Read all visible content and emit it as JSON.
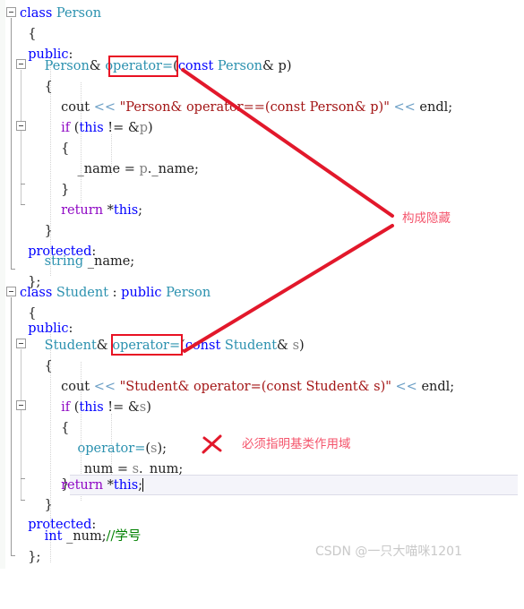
{
  "editor": {
    "language": "cpp",
    "background": "#ffffff",
    "current_line_index": 22,
    "caret_visible": true,
    "colors": {
      "keyword": "#0000ff",
      "type": "#2b91af",
      "control": "#8f08c4",
      "string": "#a31515",
      "comment": "#008000",
      "identifier": "#1f1f1f",
      "variable": "#808080",
      "stream_operator": "#6a9ec5",
      "annotation_box": "#e81123",
      "annotation_text": "#f4556c",
      "watermark": "#c9c9c9"
    },
    "lines": [
      {
        "n": 0,
        "indent": 0,
        "text": "class Person"
      },
      {
        "n": 1,
        "indent": 1,
        "text": "{"
      },
      {
        "n": 2,
        "indent": 1,
        "text": "public:"
      },
      {
        "n": 3,
        "indent": 2,
        "text": "Person& operator=(const Person& p)"
      },
      {
        "n": 4,
        "indent": 2,
        "text": "{"
      },
      {
        "n": 5,
        "indent": 3,
        "text": "cout << \"Person& operator==(const Person& p)\" << endl;"
      },
      {
        "n": 6,
        "indent": 3,
        "text": "if (this != &p)"
      },
      {
        "n": 7,
        "indent": 3,
        "text": "{"
      },
      {
        "n": 8,
        "indent": 4,
        "text": "_name = p._name;"
      },
      {
        "n": 9,
        "indent": 3,
        "text": "}"
      },
      {
        "n": 10,
        "indent": 3,
        "text": "return *this;"
      },
      {
        "n": 11,
        "indent": 2,
        "text": "}"
      },
      {
        "n": 12,
        "indent": 1,
        "text": "protected:"
      },
      {
        "n": 13,
        "indent": 2,
        "text": "string _name;"
      },
      {
        "n": 14,
        "indent": 1,
        "text": "};"
      },
      {
        "n": 15,
        "indent": 0,
        "text": ""
      },
      {
        "n": 16,
        "indent": 0,
        "text": "class Student : public Person"
      },
      {
        "n": 17,
        "indent": 1,
        "text": "{"
      },
      {
        "n": 18,
        "indent": 1,
        "text": "public:"
      },
      {
        "n": 19,
        "indent": 2,
        "text": "Student& operator=(const Student& s)"
      },
      {
        "n": 20,
        "indent": 2,
        "text": "{"
      },
      {
        "n": 21,
        "indent": 3,
        "text": "cout << \"Student& operator=(const Student& s)\" << endl;"
      },
      {
        "n": 22,
        "indent": 3,
        "text": "if (this != &s)"
      },
      {
        "n": 23,
        "indent": 3,
        "text": "{"
      },
      {
        "n": 24,
        "indent": 4,
        "text": "operator=(s);"
      },
      {
        "n": 25,
        "indent": 4,
        "text": "_num = s._num;"
      },
      {
        "n": 26,
        "indent": 3,
        "text": "}"
      },
      {
        "n": 27,
        "indent": 3,
        "text": "return *this;"
      },
      {
        "n": 28,
        "indent": 2,
        "text": "}"
      },
      {
        "n": 29,
        "indent": 1,
        "text": "protected:"
      },
      {
        "n": 30,
        "indent": 2,
        "text": "int _num;//学号"
      },
      {
        "n": 31,
        "indent": 1,
        "text": "};"
      }
    ]
  },
  "annotations": {
    "highlight_boxes": [
      {
        "id": "person-operator-eq-box",
        "target": "operator= in Person"
      },
      {
        "id": "student-operator-eq-box",
        "target": "operator= in Student"
      }
    ],
    "note_hiding": "构成隐藏",
    "note_scope": "必须指明基类作用域",
    "cross_mark": "✗"
  },
  "watermark": {
    "text": "CSDN @一只大喵咪1201"
  }
}
